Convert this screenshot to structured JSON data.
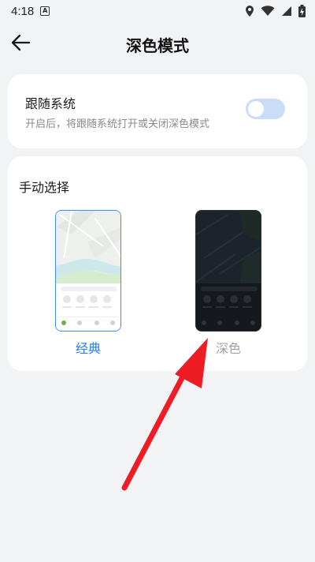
{
  "status_bar": {
    "time": "4:18",
    "notification_glyph": "A",
    "icons": [
      "location-icon",
      "wifi-icon",
      "signal-icon",
      "battery-charging-icon"
    ]
  },
  "header": {
    "title": "深色模式",
    "back_icon": "arrow-left-icon"
  },
  "follow_system": {
    "title": "跟随系统",
    "description": "开启后，将跟随系统打开或关闭深色模式",
    "toggle_on": false
  },
  "manual": {
    "title": "手动选择",
    "options": [
      {
        "label": "经典",
        "selected": true
      },
      {
        "label": "深色",
        "selected": false
      }
    ]
  },
  "colors": {
    "accent": "#1f7ef0",
    "toggle_track": "#c9ddf9",
    "annotation_arrow": "#ee1c25"
  }
}
